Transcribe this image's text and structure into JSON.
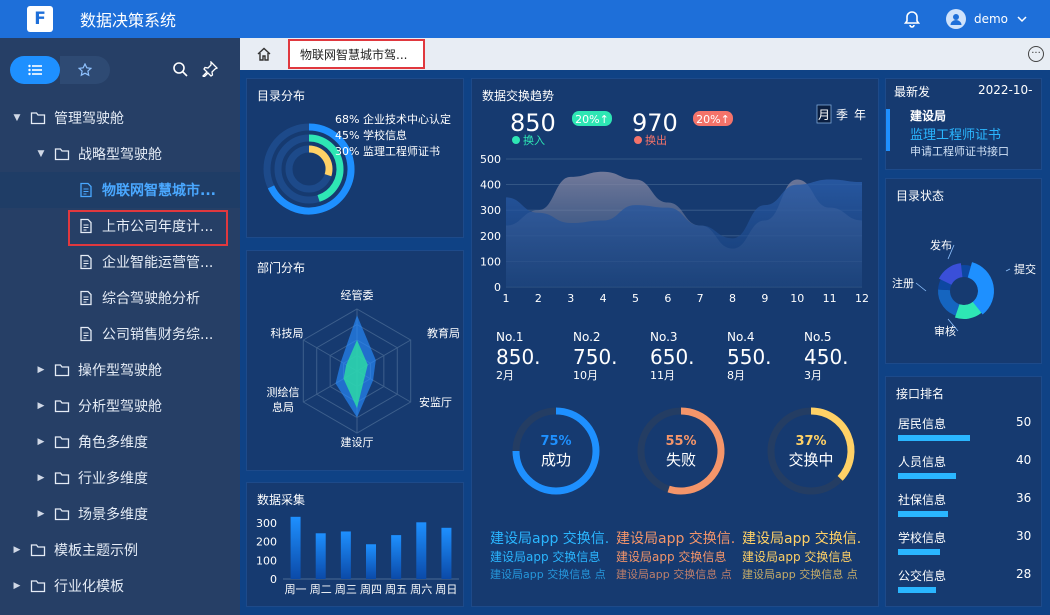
{
  "app": {
    "title": "数据决策系统",
    "user": "demo",
    "logo_letter": "F"
  },
  "sidebar": {
    "items": [
      {
        "label": "管理驾驶舱",
        "level": 0,
        "type": "folder",
        "expanded": true
      },
      {
        "label": "战略型驾驶舱",
        "level": 1,
        "type": "folder",
        "expanded": true
      },
      {
        "label": "物联网智慧城市...",
        "level": 2,
        "type": "doc",
        "active": true
      },
      {
        "label": "上市公司年度计...",
        "level": 2,
        "type": "doc"
      },
      {
        "label": "企业智能运营管...",
        "level": 2,
        "type": "doc"
      },
      {
        "label": "综合驾驶舱分析",
        "level": 2,
        "type": "doc"
      },
      {
        "label": "公司销售财务综...",
        "level": 2,
        "type": "doc"
      },
      {
        "label": "操作型驾驶舱",
        "level": 1,
        "type": "folder"
      },
      {
        "label": "分析型驾驶舱",
        "level": 1,
        "type": "folder"
      },
      {
        "label": "角色多维度",
        "level": 1,
        "type": "folder"
      },
      {
        "label": "行业多维度",
        "level": 1,
        "type": "folder"
      },
      {
        "label": "场景多维度",
        "level": 1,
        "type": "folder"
      },
      {
        "label": "模板主题示例",
        "level": 0,
        "type": "folder"
      },
      {
        "label": "行业化模板",
        "level": 0,
        "type": "folder"
      }
    ]
  },
  "tabs": {
    "active": "物联网智慧城市驾..."
  },
  "dashboard": {
    "catalog": {
      "title": "目录分布",
      "items": [
        {
          "pct": "68%",
          "label": "企业技术中心认定",
          "value": 0.68,
          "color": "#1e90ff"
        },
        {
          "pct": "45%",
          "label": "学校信息",
          "value": 0.45,
          "color": "#2ee6b4"
        },
        {
          "pct": "30%",
          "label": "监理工程师证书",
          "value": 0.3,
          "color": "#ffd166"
        }
      ]
    },
    "dept": {
      "title": "部门分布",
      "axes": [
        "经管委",
        "教育局",
        "安监厅",
        "建设厅",
        "测绘信息局",
        "科技局"
      ],
      "axes_display": [
        "经管委",
        "教育局",
        "安监厅",
        "建设厅",
        "测绘信",
        "息局",
        "科技局"
      ],
      "series_a": [
        0.9,
        0.35,
        0.3,
        0.75,
        0.4,
        0.3
      ],
      "series_b": [
        0.5,
        0.2,
        0.15,
        0.6,
        0.25,
        0.2
      ]
    },
    "collect": {
      "title": "数据采集",
      "yticks": [
        "300",
        "200",
        "100",
        "0"
      ],
      "categories": [
        "周一",
        "周二",
        "周三",
        "周四",
        "周五",
        "周六",
        "周日"
      ],
      "values": [
        340,
        250,
        260,
        190,
        240,
        310,
        280
      ],
      "ymax": 350
    },
    "trend": {
      "title": "数据交换趋势",
      "in_value": "850",
      "in_badge": "20%↑",
      "in_label": "换入",
      "out_value": "970",
      "out_badge": "20%↑",
      "out_label": "换出",
      "periods": [
        "月",
        "季",
        "年"
      ],
      "active_period": "月",
      "yticks": [
        "500",
        "400",
        "300",
        "200",
        "100",
        "0"
      ],
      "xticks": [
        "1",
        "2",
        "3",
        "4",
        "5",
        "6",
        "7",
        "8",
        "9",
        "10",
        "11",
        "12"
      ]
    },
    "ranks": [
      {
        "no": "No.1",
        "value": "850.",
        "month": "2月"
      },
      {
        "no": "No.2",
        "value": "750.",
        "month": "10月"
      },
      {
        "no": "No.3",
        "value": "650.",
        "month": "11月"
      },
      {
        "no": "No.4",
        "value": "550.",
        "month": "8月"
      },
      {
        "no": "No.5",
        "value": "450.",
        "month": "3月"
      }
    ],
    "rings": [
      {
        "pct": "75%",
        "label": "成功",
        "value": 0.75,
        "color": "#1e90ff"
      },
      {
        "pct": "55%",
        "label": "失败",
        "value": 0.55,
        "color": "#f4956a"
      },
      {
        "pct": "37%",
        "label": "交换中",
        "value": 0.37,
        "color": "#ffd166"
      }
    ],
    "marquee": {
      "line1": [
        "建设局app 交换信.",
        "建设局app 交换信.",
        "建设局app 交换信."
      ],
      "line2": [
        "建设局app 交换信息 ",
        "建设局app 交换信息 ",
        "建设局app 交换信息 "
      ],
      "line3": [
        "建设局app 交换信息 点",
        "建设局app 交换信息 点",
        "建设局app 交换信息 点"
      ]
    },
    "latest": {
      "title": "最新发",
      "date": "2022-10-",
      "org": "建设局",
      "doc": "监理工程师证书",
      "desc": "申请工程师证书接口"
    },
    "status": {
      "title": "目录状态",
      "labels": [
        "发布",
        "提交",
        "注册",
        "审核"
      ]
    },
    "iface": {
      "title": "接口排名",
      "items": [
        {
          "label": "居民信息",
          "value": "50",
          "bar": 0.72
        },
        {
          "label": "人员信息",
          "value": "40",
          "bar": 0.58
        },
        {
          "label": "社保信息",
          "value": "36",
          "bar": 0.5
        },
        {
          "label": "学校信息",
          "value": "30",
          "bar": 0.42
        },
        {
          "label": "公交信息",
          "value": "28",
          "bar": 0.38
        }
      ]
    }
  }
}
